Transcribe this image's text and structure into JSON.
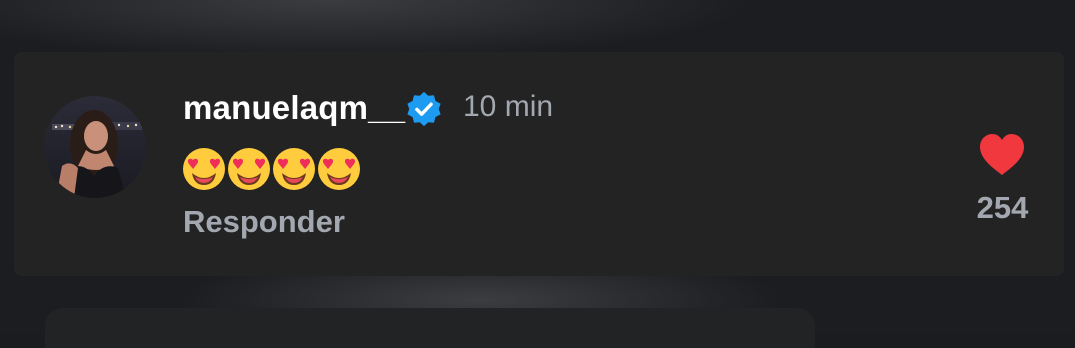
{
  "comment": {
    "username": "manuelaqm__",
    "verified": true,
    "time": "10 min",
    "text": "😍😍😍😍",
    "reply_label": "Responder",
    "likes": "254",
    "liked": true
  },
  "icons": {
    "verified": "verified-badge-icon",
    "like": "heart-icon",
    "emoji": "heart-eyes-emoji"
  },
  "colors": {
    "card_background": "#232323",
    "username": "#ffffff",
    "secondary_text": "#a3a8b0",
    "verified_badge": "#1d9bf0",
    "heart": "#f0383e"
  }
}
